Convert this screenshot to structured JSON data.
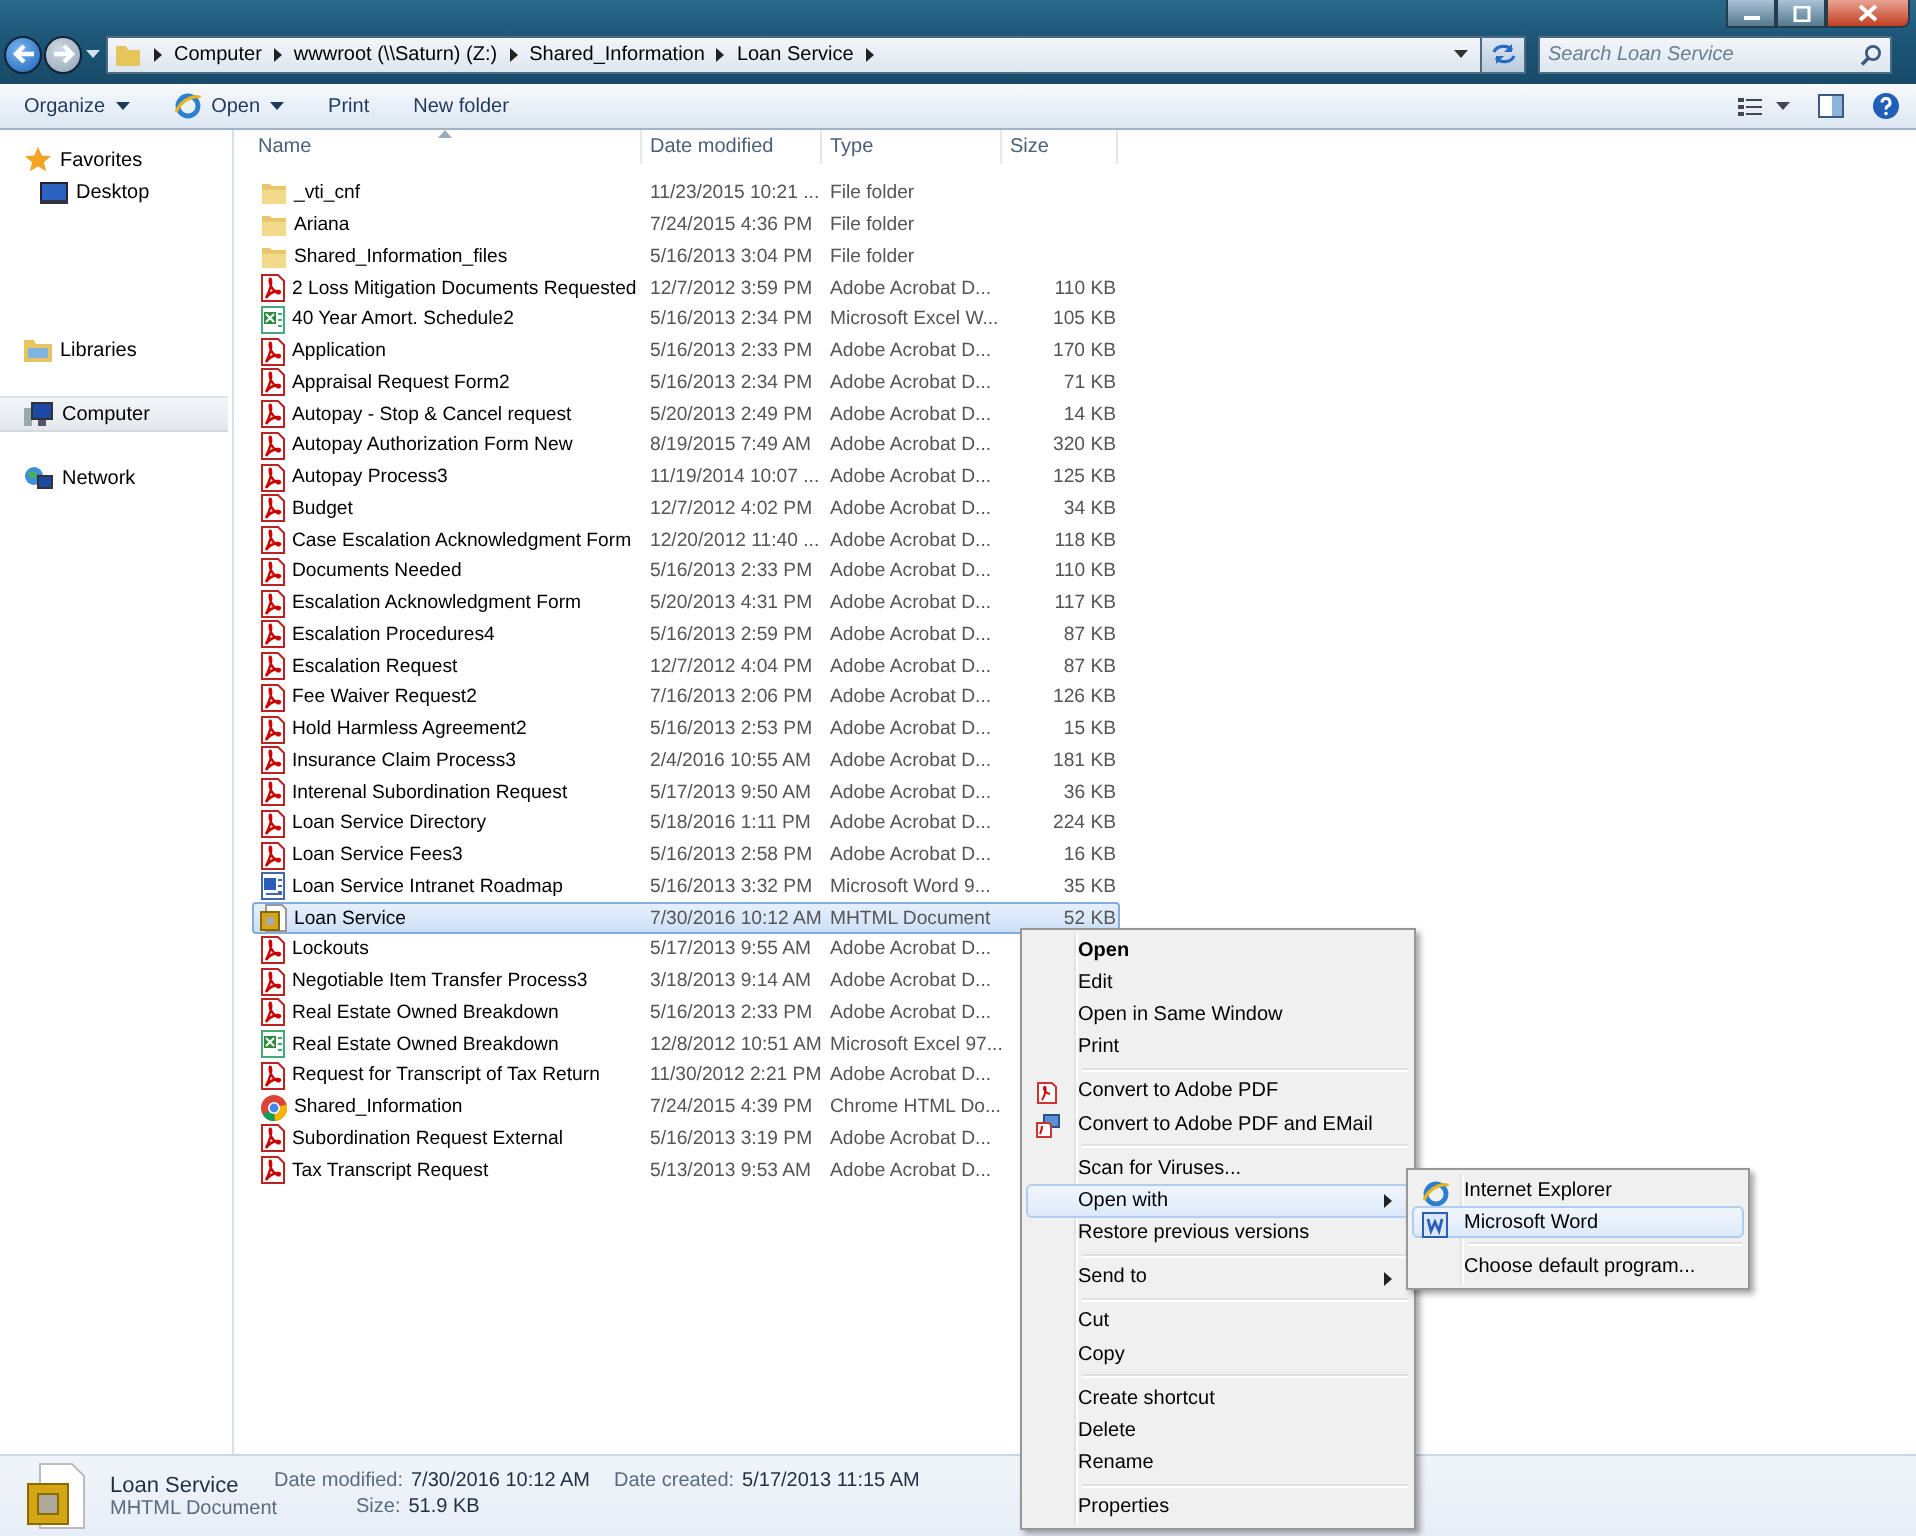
{
  "address": {
    "crumbs": [
      "Computer",
      "wwwroot (\\\\Saturn) (Z:)",
      "Shared_Information",
      "Loan Service"
    ]
  },
  "search": {
    "placeholder": "Search Loan Service"
  },
  "toolbar": [
    {
      "label": "Organize",
      "dropdown": true
    },
    {
      "label": "Open",
      "dropdown": true
    },
    {
      "label": "Print",
      "dropdown": false
    },
    {
      "label": "New folder",
      "dropdown": false
    }
  ],
  "sidebar": {
    "groups": [
      {
        "label": "Favorites",
        "selected": false,
        "children": [
          {
            "label": "Desktop",
            "selected": false
          }
        ]
      },
      {
        "label": "Libraries",
        "selected": false
      },
      {
        "label": "Computer",
        "selected": true
      },
      {
        "label": "Network",
        "selected": false
      }
    ]
  },
  "table": {
    "columns": [
      "Name",
      "Date modified",
      "Type",
      "Size"
    ],
    "rows": [
      {
        "name": "_vti_cnf",
        "date": "11/23/2015 10:21 ...",
        "type": "File folder",
        "kind": "folder",
        "selected": false
      },
      {
        "name": "Ariana",
        "date": "7/24/2015 4:36 PM",
        "type": "File folder",
        "kind": "folder",
        "selected": false
      },
      {
        "name": "Shared_Information_files",
        "date": "5/16/2013 3:04 PM",
        "type": "File folder",
        "kind": "folder",
        "selected": false
      },
      {
        "name": "2 Loss Mitigation Documents Requested",
        "date": "12/7/2012 3:59 PM",
        "type": "Adobe Acrobat D...",
        "size": "110 KB",
        "kind": "pdf",
        "selected": false
      },
      {
        "name": "40 Year Amort. Schedule2",
        "date": "5/16/2013 2:34 PM",
        "type": "Microsoft Excel W...",
        "size": "105 KB",
        "kind": "excel",
        "selected": false
      },
      {
        "name": "Application",
        "date": "5/16/2013 2:33 PM",
        "type": "Adobe Acrobat D...",
        "size": "170 KB",
        "kind": "pdf",
        "selected": false
      },
      {
        "name": "Appraisal Request Form2",
        "date": "5/16/2013 2:34 PM",
        "type": "Adobe Acrobat D...",
        "size": "71 KB",
        "kind": "pdf",
        "selected": false
      },
      {
        "name": "Autopay - Stop & Cancel request",
        "date": "5/20/2013 2:49 PM",
        "type": "Adobe Acrobat D...",
        "size": "14 KB",
        "kind": "pdf",
        "selected": false
      },
      {
        "name": "Autopay Authorization Form New",
        "date": "8/19/2015 7:49 AM",
        "type": "Adobe Acrobat D...",
        "size": "320 KB",
        "kind": "pdf",
        "selected": false
      },
      {
        "name": "Autopay Process3",
        "date": "11/19/2014 10:07 ...",
        "type": "Adobe Acrobat D...",
        "size": "125 KB",
        "kind": "pdf",
        "selected": false
      },
      {
        "name": "Budget",
        "date": "12/7/2012 4:02 PM",
        "type": "Adobe Acrobat D...",
        "size": "34 KB",
        "kind": "pdf",
        "selected": false
      },
      {
        "name": "Case Escalation Acknowledgment Form",
        "date": "12/20/2012 11:40 ...",
        "type": "Adobe Acrobat D...",
        "size": "118 KB",
        "kind": "pdf",
        "selected": false
      },
      {
        "name": "Documents Needed",
        "date": "5/16/2013 2:33 PM",
        "type": "Adobe Acrobat D...",
        "size": "110 KB",
        "kind": "pdf",
        "selected": false
      },
      {
        "name": "Escalation Acknowledgment Form",
        "date": "5/20/2013 4:31 PM",
        "type": "Adobe Acrobat D...",
        "size": "117 KB",
        "kind": "pdf",
        "selected": false
      },
      {
        "name": "Escalation Procedures4",
        "date": "5/16/2013 2:59 PM",
        "type": "Adobe Acrobat D...",
        "size": "87 KB",
        "kind": "pdf",
        "selected": false
      },
      {
        "name": "Escalation Request",
        "date": "12/7/2012 4:04 PM",
        "type": "Adobe Acrobat D...",
        "size": "87 KB",
        "kind": "pdf",
        "selected": false
      },
      {
        "name": "Fee Waiver Request2",
        "date": "7/16/2013 2:06 PM",
        "type": "Adobe Acrobat D...",
        "size": "126 KB",
        "kind": "pdf",
        "selected": false
      },
      {
        "name": "Hold Harmless Agreement2",
        "date": "5/16/2013 2:53 PM",
        "type": "Adobe Acrobat D...",
        "size": "15 KB",
        "kind": "pdf",
        "selected": false
      },
      {
        "name": "Insurance Claim Process3",
        "date": "2/4/2016 10:55 AM",
        "type": "Adobe Acrobat D...",
        "size": "181 KB",
        "kind": "pdf",
        "selected": false
      },
      {
        "name": "Interenal Subordination Request",
        "date": "5/17/2013 9:50 AM",
        "type": "Adobe Acrobat D...",
        "size": "36 KB",
        "kind": "pdf",
        "selected": false
      },
      {
        "name": "Loan Service Directory",
        "date": "5/18/2016 1:11 PM",
        "type": "Adobe Acrobat D...",
        "size": "224 KB",
        "kind": "pdf",
        "selected": false
      },
      {
        "name": "Loan Service Fees3",
        "date": "5/16/2013 2:58 PM",
        "type": "Adobe Acrobat D...",
        "size": "16 KB",
        "kind": "pdf",
        "selected": false
      },
      {
        "name": "Loan Service Intranet Roadmap",
        "date": "5/16/2013 3:32 PM",
        "type": "Microsoft Word 9...",
        "size": "35 KB",
        "kind": "word",
        "selected": false
      },
      {
        "name": "Loan Service",
        "date": "7/30/2016 10:12 AM",
        "type": "MHTML Document",
        "size": "52 KB",
        "kind": "mhtml",
        "selected": true
      },
      {
        "name": "Lockouts",
        "date": "5/17/2013 9:55 AM",
        "type": "Adobe Acrobat D...",
        "kind": "pdf",
        "selected": false
      },
      {
        "name": "Negotiable Item Transfer Process3",
        "date": "3/18/2013 9:14 AM",
        "type": "Adobe Acrobat D...",
        "kind": "pdf",
        "selected": false
      },
      {
        "name": "Real Estate Owned Breakdown",
        "date": "5/16/2013 2:33 PM",
        "type": "Adobe Acrobat D...",
        "kind": "pdf",
        "selected": false
      },
      {
        "name": "Real Estate Owned Breakdown",
        "date": "12/8/2012 10:51 AM",
        "type": "Microsoft Excel 97...",
        "kind": "excel",
        "selected": false
      },
      {
        "name": "Request for Transcript of Tax Return",
        "date": "11/30/2012 2:21 PM",
        "type": "Adobe Acrobat D...",
        "kind": "pdf",
        "selected": false
      },
      {
        "name": "Shared_Information",
        "date": "7/24/2015 4:39 PM",
        "type": "Chrome HTML Do...",
        "kind": "chrome",
        "selected": false
      },
      {
        "name": "Subordination Request External",
        "date": "5/16/2013 3:19 PM",
        "type": "Adobe Acrobat D...",
        "kind": "pdf",
        "selected": false
      },
      {
        "name": "Tax Transcript Request",
        "date": "5/13/2013 9:53 AM",
        "type": "Adobe Acrobat D...",
        "kind": "pdf",
        "selected": false
      }
    ]
  },
  "context_menu": {
    "sections": [
      [
        {
          "label": "Open",
          "bold": true,
          "submenu": false,
          "highlighted": false
        },
        {
          "label": "Edit",
          "bold": false,
          "submenu": false,
          "highlighted": false
        },
        {
          "label": "Open in Same Window",
          "bold": false,
          "submenu": false,
          "highlighted": false
        },
        {
          "label": "Print",
          "bold": false,
          "submenu": false,
          "highlighted": false
        }
      ],
      [
        {
          "label": "Convert to Adobe PDF",
          "bold": false,
          "submenu": false,
          "highlighted": false
        },
        {
          "label": "Convert to Adobe PDF and EMail",
          "bold": false,
          "submenu": false,
          "highlighted": false
        }
      ],
      [
        {
          "label": "Scan for Viruses...",
          "bold": false,
          "submenu": false,
          "highlighted": false
        },
        {
          "label": "Open with",
          "bold": false,
          "submenu": true,
          "highlighted": true
        },
        {
          "label": "Restore previous versions",
          "bold": false,
          "submenu": false,
          "highlighted": false
        }
      ],
      [
        {
          "label": "Send to",
          "bold": false,
          "submenu": true,
          "highlighted": false
        }
      ],
      [
        {
          "label": "Cut",
          "bold": false,
          "submenu": false,
          "highlighted": false
        },
        {
          "label": "Copy",
          "bold": false,
          "submenu": false,
          "highlighted": false
        }
      ],
      [
        {
          "label": "Create shortcut",
          "bold": false,
          "submenu": false,
          "highlighted": false
        },
        {
          "label": "Delete",
          "bold": false,
          "submenu": false,
          "highlighted": false
        },
        {
          "label": "Rename",
          "bold": false,
          "submenu": false,
          "highlighted": false
        }
      ],
      [
        {
          "label": "Properties",
          "bold": false,
          "submenu": false,
          "highlighted": false
        }
      ]
    ]
  },
  "submenu": {
    "sections": [
      [
        {
          "label": "Internet Explorer",
          "highlighted": false
        },
        {
          "label": "Microsoft Word",
          "highlighted": true
        }
      ],
      [
        {
          "label": "Choose default program...",
          "highlighted": false
        }
      ]
    ]
  },
  "details": {
    "name": "Loan Service",
    "type": "MHTML Document",
    "fields": [
      {
        "label": "Date modified:",
        "value": "7/30/2016 10:12 AM"
      },
      {
        "label": "Size:",
        "value": "51.9 KB"
      },
      {
        "label": "Date created:",
        "value": "5/17/2013 11:15 AM"
      }
    ]
  }
}
